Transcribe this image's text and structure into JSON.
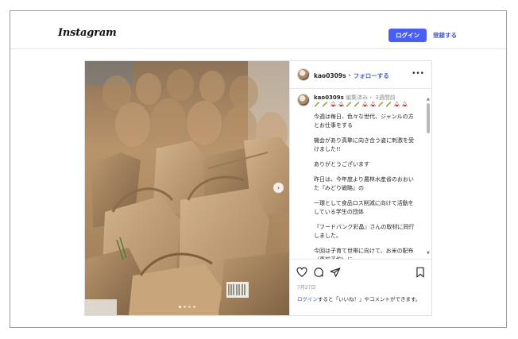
{
  "header": {
    "logo": "Instagram",
    "login_label": "ログイン",
    "signup_label": "登録する"
  },
  "post": {
    "author": "kao0309s",
    "separator": " • ",
    "follow_label": "フォローする",
    "caption": {
      "username": "kao0309s",
      "meta": " 編集済み・ 3週間前",
      "emoji_row": [
        "rice-plant",
        "rice-plant",
        "onigiri",
        "onigiri",
        "rice-plant",
        "rice-plant",
        "onigiri",
        "onigiri",
        "rice-plant",
        "rice-plant",
        "onigiri",
        "onigiri"
      ],
      "paragraphs": [
        "今週は毎日、色々な世代、ジャンルの方とお仕事をする",
        "機会があり真摯に向き合う姿に刺激を受けました!!",
        "ありがとうございます",
        "昨日は、今年度より農林水産省のおおいた『みどり戦略』の",
        "一環として食品ロス削減に向けて活動をしている学生の団体",
        "『フードバンク彩晶』さんの取材に同行しました。",
        "今回は子育て世帯に向けて、お米の配布（事前予約）に"
      ]
    },
    "date": "7月27日",
    "login_prompt_link": "ログイン",
    "login_prompt_text": "すると「いいね！」やコメントができます。",
    "image": {
      "alt_subject": "paper rice bags",
      "slide_count": 4,
      "current_slide": 1
    }
  },
  "colors": {
    "accent": "#4a5df5",
    "link": "#3f5bd8",
    "muted": "#8e8e8e"
  }
}
